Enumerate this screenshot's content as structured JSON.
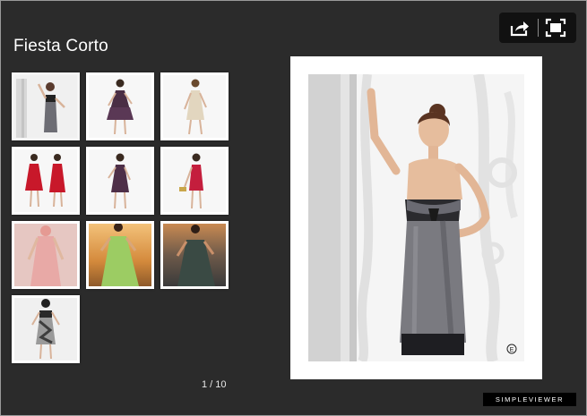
{
  "gallery": {
    "title": "Fiesta Corto",
    "counter": "1 / 10"
  },
  "toolbar": {
    "share_icon": "share-icon",
    "fullscreen_icon": "fullscreen-icon"
  },
  "thumbnails": [
    {
      "label": "thumbnail-1",
      "dress_color": "#6d6d74"
    },
    {
      "label": "thumbnail-2",
      "dress_color": "#4a2e45"
    },
    {
      "label": "thumbnail-3",
      "dress_color": "#e2d6bf"
    },
    {
      "label": "thumbnail-4",
      "dress_color": "#c8182a"
    },
    {
      "label": "thumbnail-5",
      "dress_color": "#4e2f48"
    },
    {
      "label": "thumbnail-6",
      "dress_color": "#c41e3d"
    },
    {
      "label": "thumbnail-7",
      "dress_color": "#e8a9a6"
    },
    {
      "label": "thumbnail-8",
      "dress_color": "#9ccc63"
    },
    {
      "label": "thumbnail-9",
      "dress_color": "#3a4a44"
    },
    {
      "label": "thumbnail-10",
      "dress_color": "#3d3d3d"
    }
  ],
  "selected_index": 0,
  "photo": {
    "watermark": "E"
  },
  "credit": {
    "label": "SIMPLEVIEWER"
  }
}
